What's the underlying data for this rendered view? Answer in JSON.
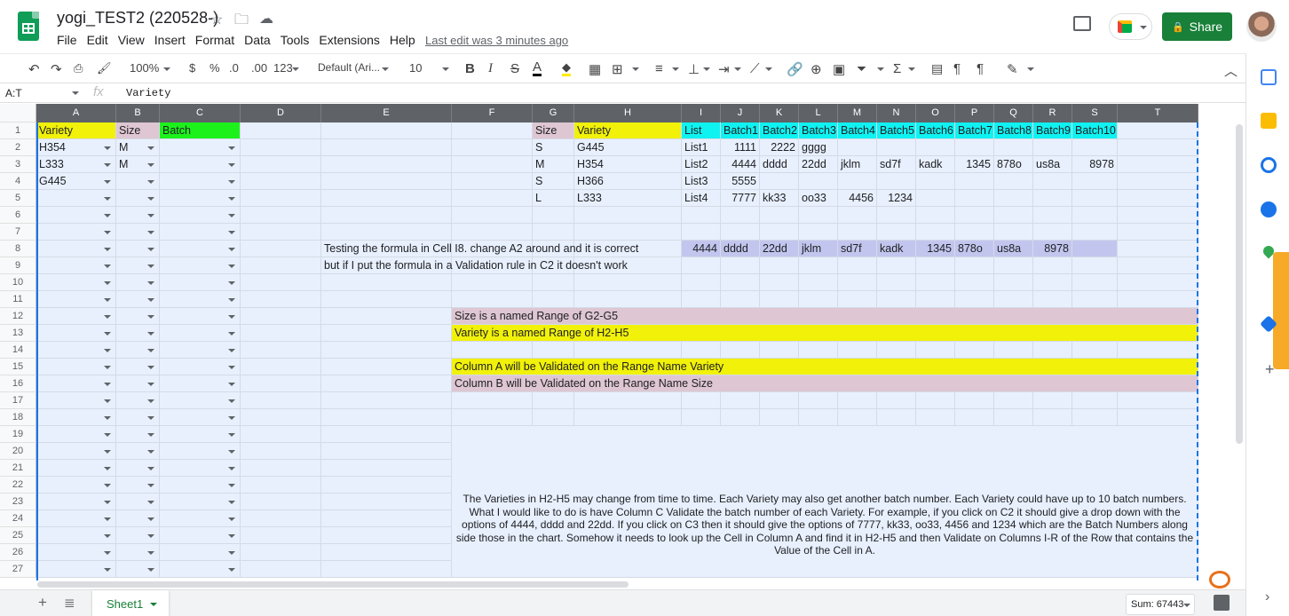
{
  "app": {
    "title": "yogi_TEST2 (220528-)",
    "last_edit": "Last edit was 3 minutes ago",
    "share_label": "Share",
    "menu": [
      "File",
      "Edit",
      "View",
      "Insert",
      "Format",
      "Data",
      "Tools",
      "Extensions",
      "Help"
    ]
  },
  "toolbar": {
    "zoom": "100%",
    "currency": "$",
    "percent": "%",
    "dec_dec": ".0",
    "dec_inc": ".00",
    "more_formats": "123",
    "font": "Default (Ari...",
    "font_size": "10"
  },
  "formula_bar": {
    "name_box": "A:T",
    "fx": "fx",
    "value": "Variety"
  },
  "columns": [
    "A",
    "B",
    "C",
    "D",
    "E",
    "F",
    "G",
    "H",
    "I",
    "J",
    "K",
    "L",
    "M",
    "N",
    "O",
    "P",
    "Q",
    "R",
    "S",
    "T"
  ],
  "rows": [
    "1",
    "2",
    "3",
    "4",
    "5",
    "6",
    "7",
    "8",
    "9",
    "10",
    "11",
    "12",
    "13",
    "14",
    "15",
    "16",
    "17",
    "18",
    "19",
    "20",
    "21",
    "22",
    "23",
    "24",
    "25",
    "26",
    "27"
  ],
  "cells": {
    "A1": "Variety",
    "B1": "Size",
    "C1": "Batch",
    "A2": "H354",
    "B2": "M",
    "A3": "L333",
    "B3": "M",
    "A4": "G445",
    "G1": "Size",
    "H1": "Variety",
    "G2": "S",
    "H2": "G445",
    "G3": "M",
    "H3": "H354",
    "G4": "S",
    "H4": "H366",
    "G5": "L",
    "H5": "L333",
    "I1": "List",
    "J1": "Batch1",
    "K1": "Batch2",
    "L1": "Batch3",
    "M1": "Batch4",
    "N1": "Batch5",
    "O1": "Batch6",
    "P1": "Batch7",
    "Q1": "Batch8",
    "R1": "Batch9",
    "S1": "Batch10",
    "I2": "List1",
    "J2": "1111",
    "K2": "2222",
    "L2": "gggg",
    "I3": "List2",
    "J3": "4444",
    "K3": "dddd",
    "L3": "22dd",
    "M3": "jklm",
    "N3": "sd7f",
    "O3": "kadk",
    "P3": "1345",
    "Q3": "878o",
    "R3": "us8a",
    "S3": "8978",
    "I4": "List3",
    "J4": "5555",
    "I5": "List4",
    "J5": "7777",
    "K5": "kk33",
    "L5": "oo33",
    "M5": "4456",
    "N5": "1234",
    "E8": "Testing the formula in Cell I8.  change A2 around and it is correct",
    "E9": "but if I put the formula in a Validation rule in C2 it doesn't work",
    "I8": "4444",
    "J8": "dddd",
    "K8": "22dd",
    "L8": "jklm",
    "M8": "sd7f",
    "N8": "kadk",
    "O8": "1345",
    "P8": "878o",
    "Q8": "us8a",
    "R8": "8978",
    "F12": "Size is a named Range of G2-G5",
    "F13": "Variety is a named Range of H2-H5",
    "F15": "Column A will be Validated on the Range Name Variety",
    "F16": "Column B will be Validated on the Range Name Size",
    "F19": "The Varieties in H2-H5 may change from time to time.  Each Variety may also get another batch number.  Each Variety could have up to 10 batch numbers.  What I would like to do is have Column C Validate the batch number of each Variety.  For example, if you click on C2 it should give a drop down with the options of 4444, dddd and 22dd.  If you click on C3 then it should give the options of 7777,  kk33, oo33, 4456 and 1234 which are the Batch Numbers along side those in the chart.  Somehow it needs to look up the Cell in Column A and find it in H2-H5 and then Validate on Columns I-R of the Row that contains the Value of the Cell in A."
  },
  "colors": {
    "yellow": "#f1f10a",
    "pink": "#dec6d2",
    "green": "#1cf11c",
    "cyan": "#0ff2f2",
    "lavender": "#c2c6ee",
    "selection": "#e8f0fe",
    "share": "#188038"
  },
  "sheet": {
    "tab": "Sheet1",
    "sum": "Sum: 67443"
  }
}
